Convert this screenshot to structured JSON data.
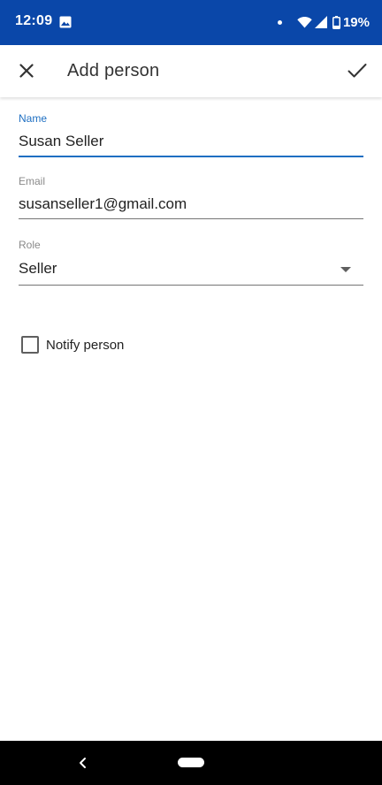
{
  "status_bar": {
    "time": "12:09",
    "battery_percent": "19%",
    "icons": [
      "image-icon",
      "dot-icon",
      "wifi-icon",
      "signal-icon",
      "battery-icon"
    ],
    "background_color": "#0a47a9"
  },
  "app_bar": {
    "title": "Add person",
    "close_icon": "close-icon",
    "confirm_icon": "check-icon"
  },
  "form": {
    "name": {
      "label": "Name",
      "value": "Susan Seller"
    },
    "email": {
      "label": "Email",
      "value": "susanseller1@gmail.com"
    },
    "role": {
      "label": "Role",
      "value": "Seller"
    },
    "notify": {
      "label": "Notify person",
      "checked": false
    }
  },
  "accent_color": "#1e6fc2",
  "nav_bar": {
    "icons": [
      "back-icon",
      "home-pill-icon"
    ]
  }
}
